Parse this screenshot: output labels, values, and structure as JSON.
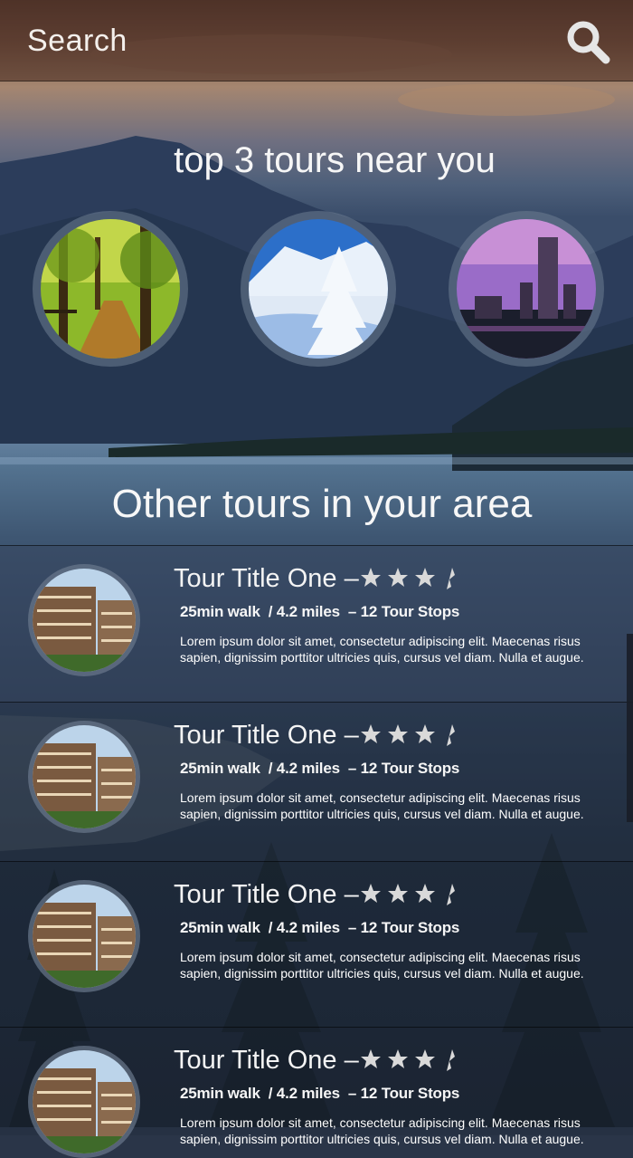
{
  "header": {
    "search_label": "Search",
    "search_icon": "search-icon"
  },
  "top_section": {
    "title": "top 3 tours near you",
    "tours": [
      {
        "icon": "forest-path-image"
      },
      {
        "icon": "snowy-tree-image"
      },
      {
        "icon": "city-skyline-image"
      }
    ]
  },
  "other_section": {
    "title": "Other tours in your area"
  },
  "tours": [
    {
      "title": "Tour Title One",
      "separator": "–",
      "rating": 3.5,
      "walk": "25min walk",
      "distance": "/ 4.2 miles",
      "stops": "– 12 Tour Stops",
      "description": "Lorem ipsum dolor sit amet, consectetur adipiscing elit. Maecenas risus sapien, dignissim porttitor ultricies quis, cursus vel diam. Nulla et augue."
    },
    {
      "title": "Tour Title One",
      "separator": "–",
      "rating": 3.5,
      "walk": "25min walk",
      "distance": "/ 4.2 miles",
      "stops": "– 12 Tour Stops",
      "description": "Lorem ipsum dolor sit amet, consectetur adipiscing elit. Maecenas risus sapien, dignissim porttitor ultricies quis, cursus vel diam. Nulla et augue."
    },
    {
      "title": "Tour Title One",
      "separator": "–",
      "rating": 3.5,
      "walk": "25min walk",
      "distance": "/ 4.2 miles",
      "stops": "– 12 Tour Stops",
      "description": "Lorem ipsum dolor sit amet, consectetur adipiscing elit. Maecenas risus sapien, dignissim porttitor ultricies quis, cursus vel diam. Nulla et augue."
    },
    {
      "title": "Tour Title One",
      "separator": "–",
      "rating": 3.5,
      "walk": "25min walk",
      "distance": "/ 4.2 miles",
      "stops": "– 12 Tour Stops",
      "description": "Lorem ipsum dolor sit amet, consectetur adipiscing elit. Maecenas risus sapien, dignissim porttitor ultricies quis, cursus vel diam. Nulla et augue."
    }
  ],
  "colors": {
    "star": "#d9d9d9",
    "header_bg": "#4a2e24"
  }
}
